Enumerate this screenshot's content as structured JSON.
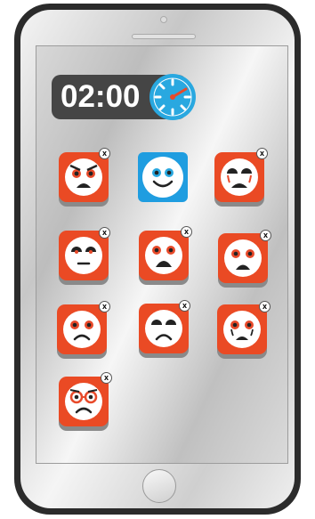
{
  "timer": {
    "time": "02:00"
  },
  "colors": {
    "tile": "#ea4a24",
    "tile_happy": "#1f9de0",
    "timer_bg": "#454545",
    "clock": "#29a8e0",
    "clock_hand": "#e84a2a"
  },
  "tiles": [
    {
      "face": "angry-face-icon",
      "close_label": "x"
    },
    {
      "face": "happy-face-icon"
    },
    {
      "face": "crying-face-icon",
      "close_label": "x"
    },
    {
      "face": "neutral-face-icon",
      "close_label": "x"
    },
    {
      "face": "shocked-face-icon",
      "close_label": "x"
    },
    {
      "face": "scared-face-icon",
      "close_label": "x"
    },
    {
      "face": "sad-face-icon",
      "close_label": "x"
    },
    {
      "face": "frowning-face-icon",
      "close_label": "x"
    },
    {
      "face": "teary-face-icon",
      "close_label": "x"
    },
    {
      "face": "glasses-frown-face-icon",
      "close_label": "x"
    }
  ]
}
